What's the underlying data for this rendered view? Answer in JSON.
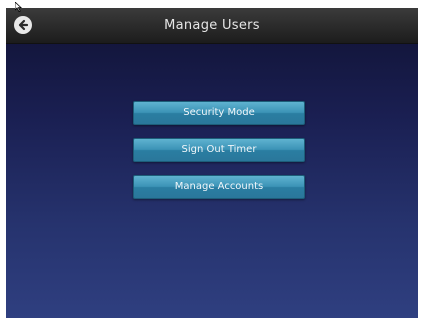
{
  "header": {
    "title": "Manage Users",
    "back_icon": "arrow-left-circle-icon"
  },
  "menu": {
    "items": [
      {
        "label": "Security Mode"
      },
      {
        "label": "Sign Out Timer"
      },
      {
        "label": "Manage Accounts"
      }
    ]
  },
  "colors": {
    "header_bg": "#2a2a2a",
    "screen_bg_top": "#101233",
    "screen_bg_bottom": "#2f3f80",
    "button_bg": "#3b93b6",
    "button_text": "#f2f7fa",
    "title_text": "#e6e6e6"
  }
}
